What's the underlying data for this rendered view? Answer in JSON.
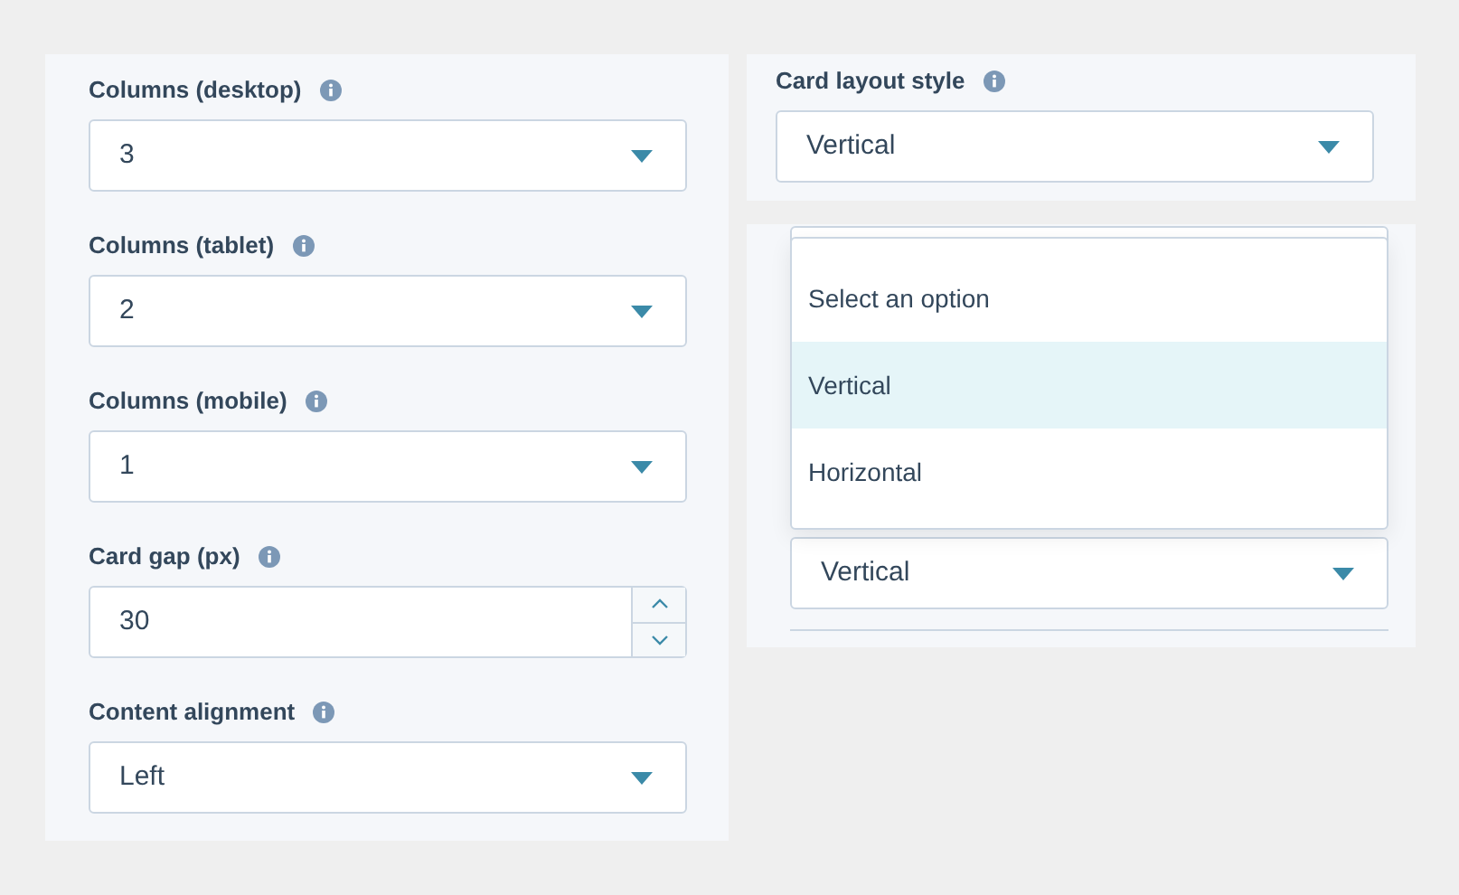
{
  "left_fields": [
    {
      "kind": "select",
      "label": "Columns (desktop)",
      "value": "3"
    },
    {
      "kind": "select",
      "label": "Columns (tablet)",
      "value": "2"
    },
    {
      "kind": "select",
      "label": "Columns (mobile)",
      "value": "1"
    },
    {
      "kind": "number",
      "label": "Card gap (px)",
      "value": "30"
    },
    {
      "kind": "select",
      "label": "Content alignment",
      "value": "Left"
    }
  ],
  "card_layout": {
    "label": "Card layout style",
    "value": "Vertical"
  },
  "dropdown_menu": {
    "options": [
      {
        "label": "Select an option",
        "selected": false
      },
      {
        "label": "Vertical",
        "selected": true
      },
      {
        "label": "Horizontal",
        "selected": false
      }
    ]
  },
  "lower_select": {
    "value": "Vertical"
  }
}
